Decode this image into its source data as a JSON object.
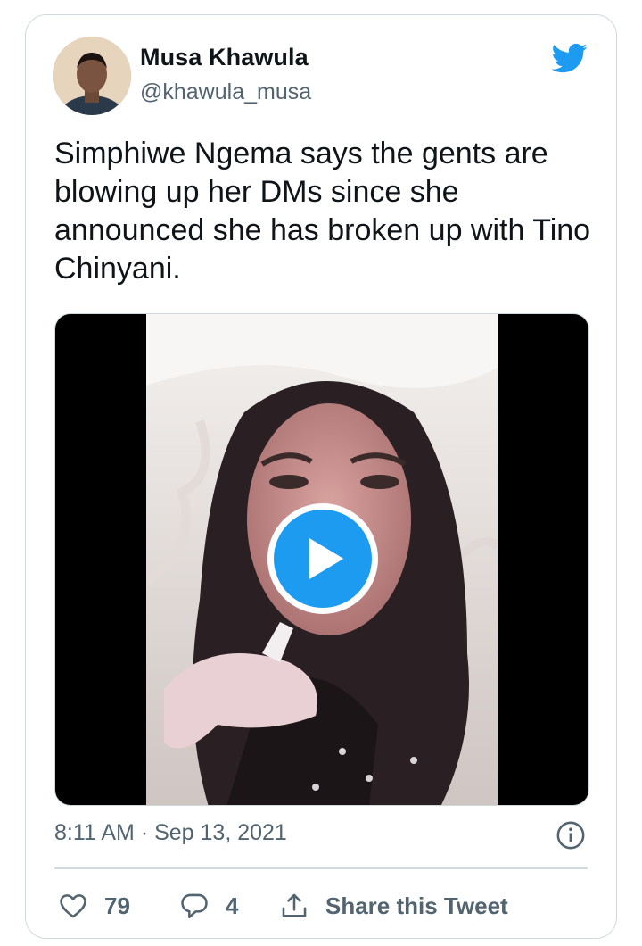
{
  "author": {
    "name": "Musa Khawula",
    "handle": "@khawula_musa"
  },
  "tweet": {
    "text": "Simphiwe Ngema says the gents are blowing up her DMs since she announced she has broken up with Tino Chinyani."
  },
  "meta": {
    "timestamp": "8:11 AM · Sep 13, 2021"
  },
  "actions": {
    "likes": "79",
    "replies": "4",
    "share_label": "Share this Tweet"
  },
  "icons": {
    "logo": "twitter-bird-icon",
    "play": "play-icon",
    "info": "info-icon",
    "like": "heart-icon",
    "reply": "reply-icon",
    "share": "share-icon"
  },
  "colors": {
    "accent": "#1d9bf0",
    "text_primary": "#0f1419",
    "text_secondary": "#536471",
    "border": "#cfd9de"
  }
}
